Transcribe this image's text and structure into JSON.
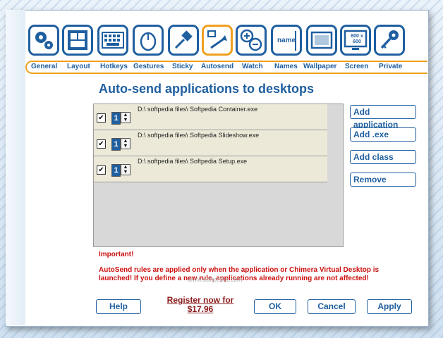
{
  "toolbar": {
    "icons": [
      {
        "name": "gears-icon"
      },
      {
        "name": "layout-icon"
      },
      {
        "name": "keyboard-icon"
      },
      {
        "name": "mouse-icon"
      },
      {
        "name": "pin-icon"
      },
      {
        "name": "autosend-icon"
      },
      {
        "name": "zoom-icon"
      },
      {
        "name": "name-tag-icon"
      },
      {
        "name": "wallpaper-icon"
      },
      {
        "name": "screen-icon"
      },
      {
        "name": "key-icon"
      }
    ],
    "screen_icon_text": "800 x 600",
    "names_icon_text": "name",
    "active_tab": "Autosend",
    "tabs": [
      "General",
      "Layout",
      "Hotkeys",
      "Gestures",
      "Sticky",
      "Autosend",
      "Watch",
      "Names",
      "Wallpaper",
      "Screen",
      "Private"
    ]
  },
  "page_title": "Auto-send applications to desktops",
  "rules": [
    {
      "checked": true,
      "desktop": "1",
      "path": "D:\\ softpedia files\\ Softpedia Container.exe"
    },
    {
      "checked": true,
      "desktop": "1",
      "path": "D:\\ softpedia files\\ Softpedia Slideshow.exe"
    },
    {
      "checked": true,
      "desktop": "1",
      "path": "D:\\ softpedia files\\ Softpedia Setup.exe"
    }
  ],
  "side_buttons": {
    "add_application": "Add application",
    "add_exe": "Add .exe",
    "add_class": "Add class",
    "remove": "Remove"
  },
  "warning": {
    "title": "Important!",
    "text": "AutoSend rules are applied only when the application or Chimera Virtual Desktop is launched! If you define a new rule, applications already running are not affected!"
  },
  "watermark": "www.softpedia.com",
  "footer": {
    "help": "Help",
    "register": "Register now for $17.96",
    "ok": "OK",
    "cancel": "Cancel",
    "apply": "Apply"
  },
  "colors": {
    "accent": "#1f5fa0",
    "highlight": "#f0a020",
    "warning": "#cc1010"
  }
}
